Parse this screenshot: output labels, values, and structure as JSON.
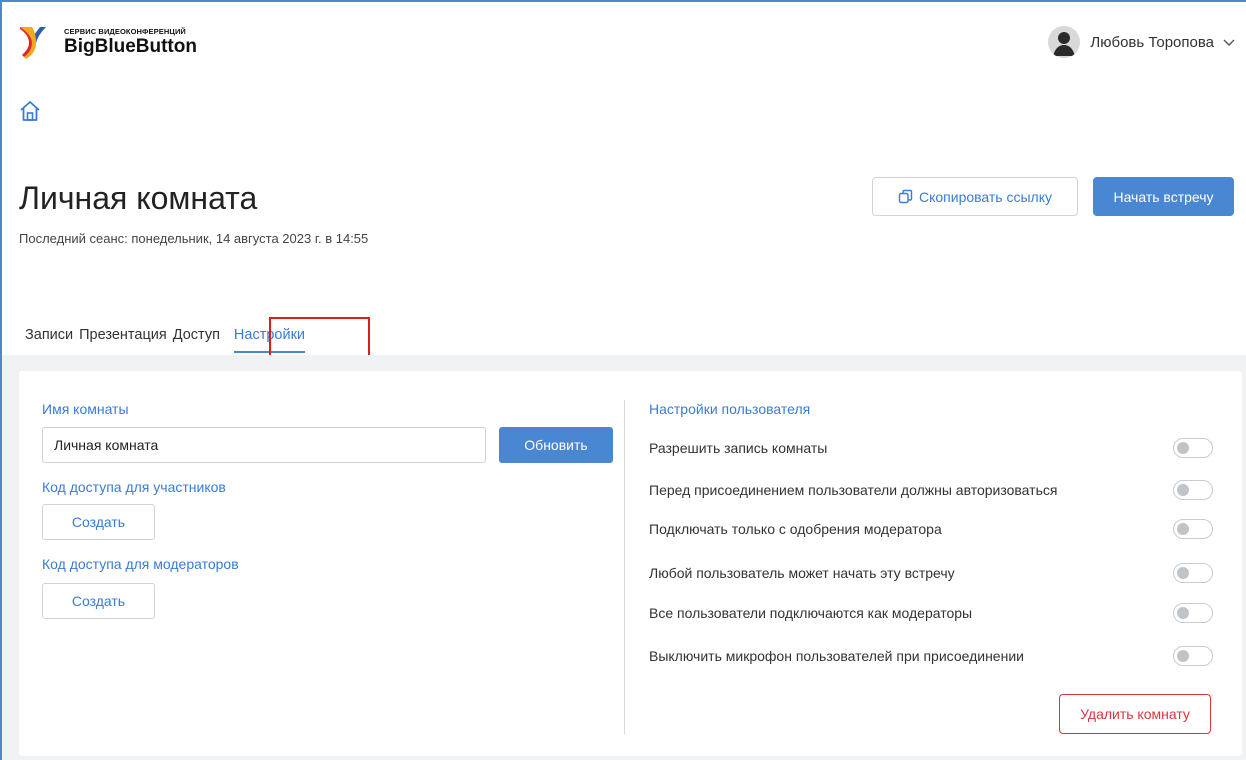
{
  "header": {
    "brand_subtitle": "СЕРВИС ВИДЕОКОНФЕРЕНЦИЙ",
    "brand_title": "BigBlueButton",
    "user_name": "Любовь Торопова"
  },
  "page": {
    "title": "Личная комната",
    "last_session": "Последний сеанс: понедельник, 14 августа 2023 г. в 14:55",
    "copy_link_label": "Скопировать ссылку",
    "start_meeting_label": "Начать встречу"
  },
  "tabs": [
    {
      "label": "Записи"
    },
    {
      "label": "Презентация"
    },
    {
      "label": "Доступ"
    },
    {
      "label": "Настройки",
      "active": true
    }
  ],
  "left_panel": {
    "room_name_label": "Имя комнаты",
    "room_name_value": "Личная комната",
    "update_label": "Обновить",
    "participant_code_label": "Код доступа для участников",
    "participant_create_label": "Создать",
    "moderator_code_label": "Код доступа для модераторов",
    "moderator_create_label": "Создать"
  },
  "right_panel": {
    "heading": "Настройки пользователя",
    "settings": [
      {
        "label": "Разрешить запись комнаты",
        "enabled": false
      },
      {
        "label": "Перед присоединением пользователи должны авторизоваться",
        "enabled": false
      },
      {
        "label": "Подключать только с одобрения модератора",
        "enabled": false
      },
      {
        "label": "Любой пользователь может начать эту встречу",
        "enabled": false
      },
      {
        "label": "Все пользователи подключаются как модераторы",
        "enabled": false
      },
      {
        "label": "Выключить микрофон пользователей при присоединении",
        "enabled": false
      }
    ],
    "delete_label": "Удалить комнату"
  },
  "colors": {
    "accent": "#4a87d3",
    "link": "#3a7bd5",
    "danger": "#d9363e",
    "highlight_box": "#e01b1b"
  }
}
